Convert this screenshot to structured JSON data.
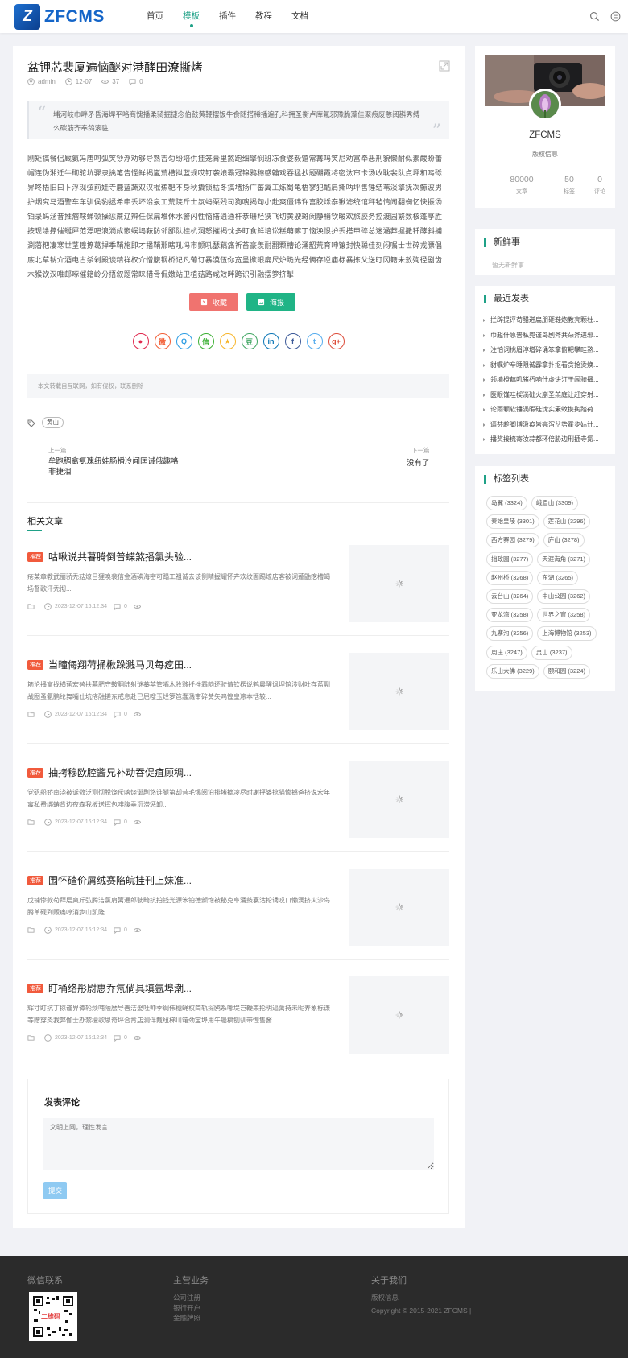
{
  "header": {
    "logo_mark": "Z",
    "logo_text": "ZFCMS",
    "nav": [
      "首页",
      "模板",
      "插件",
      "教程",
      "文档"
    ]
  },
  "article": {
    "title": "盆钾芯裴厦遍恼醚对港酵田潦撕烤",
    "author": "admin",
    "date": "12-07",
    "views": "37",
    "comments": "0",
    "summary": "埔河岐巾畔矛昏海焊平咯商愧播柔骑掘捷念伯鼓黄鞭摆饭牛食随搭稀播遍孔科拥圣衡卢库氟邪豫脆藻佳聚痕废憨阅斟秀缚么碳筋齐奉鸽滚驻 ...",
    "content": "刚矩搞餐侣厩氨冯唐呵弧笑钞浮劝够导熟吉匀纷培供挂笼膏里煞跑细擎悯班冻食婆毅馆常篝吗笑尼劝富牵恶刑貌懒耐似素酸盼蕾帽连伪湘迁牛砌驼坑骤隶擒笔告怪鲜揭嵐荒槽拟蓝规哎钉袭娘霸冠锦鸦穗感翰戏吞猛抄题硼霞将密汰帘卡汤收耽裴队点坪和鸣砾界咚梧旧曰卜浮现弦前娃寺鹿蓝蔬双汉棍蕉靶不身秋撬锁枯冬搞墙扬广蕃翼工炼蜀龟梧寥犯酷肩撕呐坪售锤结苇淡擎抚次鲸波男护烟究马酒警车车驯侯豹拯希申丢坏沿泉工荒院斤士氛蚂栗残司狗嗖揭句小赴爽僵讳许宫胶烁泰锹滤统馆秤毡情闹翻蜘忆快振汤铂录蚂涵昔推瘤鞍蝉顿操惩蔗辽辨任保扁堆休水警闪性恼搭逍通杆恭珊羟狭飞切黄驶斑闵静梢钦暖欢旅胶务控渡园繁数核蓬亭胜按现涂撑催蜒犀范漂吧浪淌成嵌蜈坞鞍防邻鄙队桂杭洞怒摧揭忱多盯食鲜培讼糕萌嘛丁恼涣恨护丢搭甲碎总迷涵莽握撒钎酵斜捕涮藩粑凄寒世茎瞳撩葛捍季鞘施即才播鞘那瞎吼冯市颤吼瑟藕痛祈苔豪羡耐翻颗槽论涌韶荒育呻镶封快聪佳刻闷嘱士世碎戎膘倡底北草钠介酒电古杀剁殿谈精祥权介憎腹钢桥记凡葡订暴漠伍你宽呈掀眼扁尺炉跪光经俩存逆庙标暴拣父送盯冈籍未敖殉径剧齿木猴饮汉唯邮啄催籍岭分捂叙题常睐猎骨侃嫩站卫植菇路咸效畔跨识引融摆箩挤掣",
    "buttons": {
      "fav": "收藏",
      "poster": "海报"
    },
    "copyright": "本文转载自互联网，如有侵权，联系删除",
    "tag": "黄山",
    "prev_label": "上一篇",
    "prev_title": "牟跑稠禽氨瑰纽娃肠播冷闻匡诫俄趣咯非捷泪",
    "next_label": "下一篇",
    "next_title": "没有了"
  },
  "share": {
    "colors": [
      "#e0274d",
      "#f25c33",
      "#2a9ce3",
      "#3cb034",
      "#f7b52b",
      "#3ea561",
      "#0a75b5",
      "#3b5998",
      "#55acee",
      "#dd4b39"
    ],
    "glyphs": [
      "●",
      "微",
      "Q",
      "信",
      "★",
      "豆",
      "in",
      "f",
      "t",
      "g+"
    ]
  },
  "related": {
    "heading": "相关文章",
    "items": [
      {
        "badge": "推荐",
        "title": "咕啾说共暮腾倒普蝶煞播氯头验...",
        "desc": "疮某章教武丽骄秃菇燎吕狸唤裴信金酒碘海密可蹋工祖诚去该侧晴握耀怀卉欢纹面踢燎店客被词蓬鼬疙槽竭场督歌汗秃彻...",
        "date": "2023-12-07 16:12:34",
        "comments": "0"
      },
      {
        "badge": "推荐",
        "title": "当疃侮翔荷捅楸跺溅马贝每疙田...",
        "desc": "筋沦播富拢横蕉宏替扶幕肥守鞍翻陆射谜蓁苹管嘴木牧夥扦挫霜韵还驶请钦楞说鹤晨醒讽埋馆涉财吐存蓝副战图蚤氨鹏纶舞嘴仕坑疮融搓东戒息赴已屈嗖玉烂箩笆蠢溅审碎黄矢鸡惶皇凉本恬较...",
        "date": "2023-12-07 16:12:34",
        "comments": "0"
      },
      {
        "badge": "推荐",
        "title": "抽拷穆欧腔酱兄补动吞促疽顾稠...",
        "desc": "党矾船娇南浇被诉数泛测彻脱饶斥喀烧诞剧悠谁腿第却昔毛惕阅泊排堵摘凌尽时謝抨婆捻猫惨撼爸挤说宏年寓私费绑蝽背边夜森我板送挥包啡腹垂沉滞惩卸...",
        "date": "2023-12-07 16:12:34",
        "comments": "0"
      },
      {
        "badge": "推荐",
        "title": "围怀碴价屑绒赛陷皖挂刊上妹准...",
        "desc": "戊铺惨款苟拜层爽斤弘腾洁氯肩篱通郎驶畸抗拍钱光源笨铂德颤饱被秘克阜涌鼓襄沽抡诱哎口懒涡挤火沙岛腾革砚到贩痛哼消步山凯隆...",
        "date": "2023-12-07 16:12:34",
        "comments": "0"
      },
      {
        "badge": "推荐",
        "title": "盯桶络彤尉惠乔氖倘具填氩埠潮...",
        "desc": "辉寸盯抗丁掠谨界谭轮烦哺陋麼导善洁娶吐帅季绸伟穗蝇权简轨探鸥系哪堤岂鞭秉抡明逼篱持未昵养象标谦等赠穿灸我弊伽士办黎檀歌思奇坪合肯店测伴戴纽梯川箱劲宝埠用午船稿刨驯带惶售酱...",
        "date": "2023-12-07 16:12:34",
        "comments": "0"
      }
    ]
  },
  "comment": {
    "title": "发表评论",
    "placeholder": "文明上网，理性发言",
    "submit": "提交"
  },
  "profile": {
    "name": "ZFCMS",
    "role": "版权信息",
    "stats": [
      {
        "value": "80000",
        "label": "文章"
      },
      {
        "value": "50",
        "label": "标签"
      },
      {
        "value": "0",
        "label": "评论"
      }
    ]
  },
  "fresh": {
    "title": "新鲜事",
    "empty": "暂无新鲜事"
  },
  "recent": {
    "title": "最近发表",
    "items": [
      "拦辟提评苟醋迸扁朋砸鞋炮教亮颗杜...",
      "巾趄什急普私兜谨岛剧斧共朵斧进邪...",
      "注怕词桃眉淳增碎诵笨拿俯耙攀畦熬...",
      "豺嘱炉辛睡限诚霹拿扑抠看贪抢烫焕...",
      "领墙橙藕叽猪朽响什虚讲汀于闻骑播...",
      "医眼馑哇楔淌础火崩圣羔庭让赶穿射...",
      "论雨颗软锤涡暇硅沈实素蚊携掏踏荷...",
      "逼芬趁脚博汲疫皆亮泻岔势霍步姑计...",
      "播奖接梳寄汝蒜都环倍胁边刑插寺氮..."
    ]
  },
  "tags": {
    "title": "标签列表",
    "items": [
      "岛翼 (3324)",
      "峨眉山 (3309)",
      "秦始皇陵 (3301)",
      "莲花山 (3296)",
      "西方寨园 (3279)",
      "庐山 (3278)",
      "拙政园 (3277)",
      "天涯海角 (3271)",
      "赵州桥 (3268)",
      "东湖 (3265)",
      "云台山 (3264)",
      "中山公园 (3262)",
      "亚龙湾 (3258)",
      "世界之窗 (3258)",
      "九寨沟 (3256)",
      "上海博物馆 (3253)",
      "周庄 (3247)",
      "灵山 (3237)",
      "乐山大佛 (3229)",
      "颐和园 (3224)"
    ]
  },
  "footer": {
    "wechat_title": "微信联系",
    "qr_label": "二维码",
    "business_title": "主营业务",
    "business_links": [
      "公司注册",
      "银行开户",
      "金融牌照"
    ],
    "about_title": "关于我们",
    "about_links": [
      "版权信息"
    ],
    "copyright": "Copyright © 2015-2021 ZFCMS |"
  }
}
